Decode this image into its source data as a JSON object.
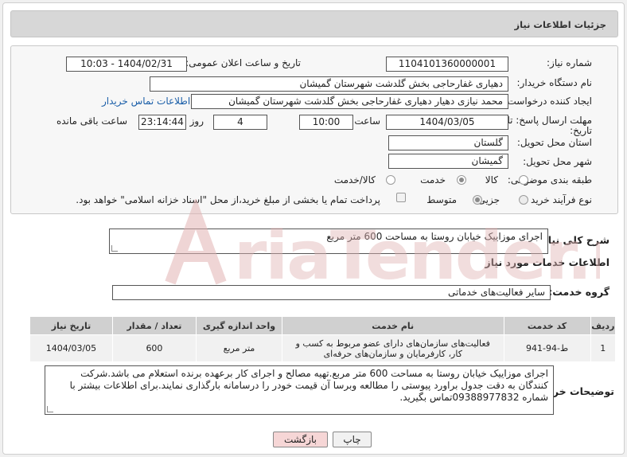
{
  "header": {
    "title": "جزئیات اطلاعات نیاز"
  },
  "fields": {
    "need_number_label": "شماره نیاز:",
    "need_number": "1104101360000001",
    "announce_label": "تاریخ و ساعت اعلان عمومی:",
    "announce_value": "1404/02/31 - 10:03",
    "buyer_org_label": "نام دستگاه خریدار:",
    "buyer_org": "دهیاری غفارحاجی بخش گلدشت شهرستان گمیشان",
    "creator_label": "ایجاد کننده درخواست:",
    "creator": "محمد نیازی دهیار دهیاری غفارحاجی بخش گلدشت شهرستان گمیشان",
    "contact_link": "اطلاعات تماس خریدار",
    "deadline_label": "مهلت ارسال پاسخ: تا تاریخ:",
    "deadline_date": "1404/03/05",
    "time_label": "ساعت",
    "deadline_time": "10:00",
    "days_value": "4",
    "days_label": "روز و",
    "remaining_time": "23:14:44",
    "remaining_label": "ساعت باقی مانده",
    "province_label": "استان محل تحویل:",
    "province": "گلستان",
    "city_label": "شهر محل تحویل:",
    "city": "گمیشان",
    "category_label": "طبقه بندی موضوعی:",
    "category_options": [
      "کالا",
      "خدمت",
      "کالا/خدمت"
    ],
    "category_selected": "خدمت",
    "process_label": "نوع فرآیند خرید :",
    "process_options": [
      "جزیی",
      "متوسط"
    ],
    "process_selected": "متوسط",
    "payment_note": "پرداخت تمام یا بخشی از مبلغ خرید،از محل \"اسناد خزانه اسلامی\" خواهد بود."
  },
  "description": {
    "label": "شرح کلی نیاز:",
    "value": "اجرای موزاییک خیابان روستا به مساحت 600 متر مربع"
  },
  "services": {
    "section_title": "اطلاعات خدمات مورد نیاز",
    "group_label": "گروه خدمت:",
    "group_value": "سایر فعالیت‌های خدماتی",
    "columns": [
      "ردیف",
      "کد خدمت",
      "نام خدمت",
      "واحد اندازه گیری",
      "تعداد / مقدار",
      "تاریخ نیاز"
    ],
    "rows": [
      {
        "index": "1",
        "code": "ط-94-941",
        "name": "فعالیت‌های سازمان‌های دارای عضو مربوط به کسب و کار، کارفرمایان و سازمان‌های حرفه‌ای",
        "unit": "متر مربع",
        "qty": "600",
        "date": "1404/03/05"
      }
    ]
  },
  "buyer_notes": {
    "label": "توضیحات خریدار:",
    "value": "اجرای موزاییک خیابان روستا به مساحت 600 متر مربع.تهیه مصالح و اجرای کار برعهده برنده استعلام می باشد.شرکت کنندگان به دقت جدول براورد پیوستی را مطالعه وبرسا آن قیمت خودر را درسامانه بارگذاری نمایند.برای اطلاعات بیشتر با شماره 09388977832تماس بگیرید."
  },
  "buttons": {
    "print": "چاپ",
    "back": "بازگشت"
  },
  "watermark": {
    "text": "AriaTender.neT"
  },
  "colors": {
    "header_bg": "#d7d7d7",
    "link": "#1a5ea8",
    "back_button_bg": "#f6d6d6",
    "watermark": "#e2b4b4"
  }
}
